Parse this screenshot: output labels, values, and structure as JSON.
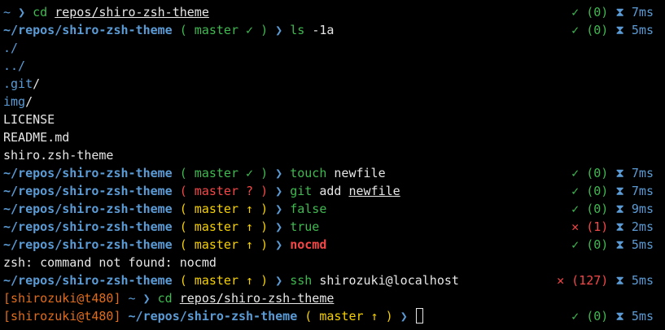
{
  "colors": {
    "background": "#000000",
    "text": "#e6e6e6",
    "path": "#5b9bd5",
    "prompt_arrow": "#5b9bd5",
    "git_clean": "#3fb950",
    "git_dirty": "#f44747",
    "git_ahead": "#f5d000",
    "command": "#3fb950",
    "command_error": "#f44747",
    "exit_ok": "#3fb950",
    "exit_fail": "#f44747",
    "duration": "#5b9bd5",
    "user_host": "#e06c1a",
    "dir_listing": "#5b9bd5"
  },
  "icons": {
    "check": "✓",
    "cross": "✕",
    "hourglass": "⧗",
    "chevron": "❯",
    "arrow_up": "↑"
  },
  "lines": [
    {
      "kind": "prompt",
      "segments": [
        {
          "t": "~ ",
          "c": "path"
        },
        {
          "t": "❯ ",
          "c": "prompt_arrow"
        },
        {
          "t": "cd ",
          "c": "command"
        },
        {
          "t": "repos/shiro-zsh-theme",
          "c": "text",
          "u": true
        }
      ],
      "status": {
        "icon": "✓",
        "code": "(0)",
        "ok": true,
        "time": "7ms"
      }
    },
    {
      "kind": "prompt",
      "segments": [
        {
          "t": "~/repos/shiro-zsh-theme ",
          "c": "path",
          "b": true
        },
        {
          "t": "( master ✓ ) ",
          "c": "git_clean"
        },
        {
          "t": "❯ ",
          "c": "prompt_arrow"
        },
        {
          "t": "ls ",
          "c": "command"
        },
        {
          "t": "-1a",
          "c": "text"
        }
      ],
      "status": {
        "icon": "✓",
        "code": "(0)",
        "ok": true,
        "time": "5ms"
      }
    },
    {
      "kind": "output",
      "segments": [
        {
          "t": "./",
          "c": "dir_listing"
        }
      ]
    },
    {
      "kind": "output",
      "segments": [
        {
          "t": "../",
          "c": "dir_listing"
        }
      ]
    },
    {
      "kind": "output",
      "segments": [
        {
          "t": ".git",
          "c": "dir_listing"
        },
        {
          "t": "/",
          "c": "text"
        }
      ]
    },
    {
      "kind": "output",
      "segments": [
        {
          "t": "img",
          "c": "dir_listing"
        },
        {
          "t": "/",
          "c": "text"
        }
      ]
    },
    {
      "kind": "output",
      "segments": [
        {
          "t": "LICENSE",
          "c": "text"
        }
      ]
    },
    {
      "kind": "output",
      "segments": [
        {
          "t": "README.md",
          "c": "text"
        }
      ]
    },
    {
      "kind": "output",
      "segments": [
        {
          "t": "shiro.zsh-theme",
          "c": "text"
        }
      ]
    },
    {
      "kind": "prompt",
      "segments": [
        {
          "t": "~/repos/shiro-zsh-theme ",
          "c": "path",
          "b": true
        },
        {
          "t": "( master ✓ ) ",
          "c": "git_clean"
        },
        {
          "t": "❯ ",
          "c": "prompt_arrow"
        },
        {
          "t": "touch ",
          "c": "command"
        },
        {
          "t": "newfile",
          "c": "text"
        }
      ],
      "status": {
        "icon": "✓",
        "code": "(0)",
        "ok": true,
        "time": "7ms"
      }
    },
    {
      "kind": "prompt",
      "segments": [
        {
          "t": "~/repos/shiro-zsh-theme ",
          "c": "path",
          "b": true
        },
        {
          "t": "( master ? ) ",
          "c": "git_dirty"
        },
        {
          "t": "❯ ",
          "c": "prompt_arrow"
        },
        {
          "t": "git ",
          "c": "command"
        },
        {
          "t": "add ",
          "c": "text"
        },
        {
          "t": "newfile",
          "c": "text",
          "u": true
        }
      ],
      "status": {
        "icon": "✓",
        "code": "(0)",
        "ok": true,
        "time": "7ms"
      }
    },
    {
      "kind": "prompt",
      "segments": [
        {
          "t": "~/repos/shiro-zsh-theme ",
          "c": "path",
          "b": true
        },
        {
          "t": "( master ↑ ) ",
          "c": "git_ahead"
        },
        {
          "t": "❯ ",
          "c": "prompt_arrow"
        },
        {
          "t": "false",
          "c": "command"
        }
      ],
      "status": {
        "icon": "✓",
        "code": "(0)",
        "ok": true,
        "time": "9ms"
      }
    },
    {
      "kind": "prompt",
      "segments": [
        {
          "t": "~/repos/shiro-zsh-theme ",
          "c": "path",
          "b": true
        },
        {
          "t": "( master ↑ ) ",
          "c": "git_ahead"
        },
        {
          "t": "❯ ",
          "c": "prompt_arrow"
        },
        {
          "t": "true",
          "c": "command"
        }
      ],
      "status": {
        "icon": "✕",
        "code": "(1)",
        "ok": false,
        "time": "2ms"
      }
    },
    {
      "kind": "prompt",
      "segments": [
        {
          "t": "~/repos/shiro-zsh-theme ",
          "c": "path",
          "b": true
        },
        {
          "t": "( master ↑ ) ",
          "c": "git_ahead"
        },
        {
          "t": "❯ ",
          "c": "prompt_arrow"
        },
        {
          "t": "nocmd",
          "c": "command_error",
          "b": true
        }
      ],
      "status": {
        "icon": "✓",
        "code": "(0)",
        "ok": true,
        "time": "5ms"
      }
    },
    {
      "kind": "output",
      "segments": [
        {
          "t": "zsh: command not found: nocmd",
          "c": "text"
        }
      ]
    },
    {
      "kind": "prompt",
      "segments": [
        {
          "t": "~/repos/shiro-zsh-theme ",
          "c": "path",
          "b": true
        },
        {
          "t": "( master ↑ ) ",
          "c": "git_ahead"
        },
        {
          "t": "❯ ",
          "c": "prompt_arrow"
        },
        {
          "t": "ssh ",
          "c": "command"
        },
        {
          "t": "shirozuki@localhost",
          "c": "text"
        }
      ],
      "status": {
        "icon": "✕",
        "code": "(127)",
        "ok": false,
        "time": "5ms"
      }
    },
    {
      "kind": "prompt",
      "segments": [
        {
          "t": "[shirozuki@t480] ",
          "c": "user_host"
        },
        {
          "t": "~ ",
          "c": "path"
        },
        {
          "t": "❯ ",
          "c": "prompt_arrow"
        },
        {
          "t": "cd ",
          "c": "command"
        },
        {
          "t": "repos/shiro-zsh-theme",
          "c": "text",
          "u": true
        }
      ]
    },
    {
      "kind": "prompt",
      "cursor": true,
      "segments": [
        {
          "t": "[shirozuki@t480] ",
          "c": "user_host"
        },
        {
          "t": "~/repos/shiro-zsh-theme ",
          "c": "path",
          "b": true
        },
        {
          "t": "( master ↑ ) ",
          "c": "git_ahead"
        },
        {
          "t": "❯ ",
          "c": "prompt_arrow"
        }
      ],
      "status": {
        "icon": "✓",
        "code": "(0)",
        "ok": true,
        "time": "5ms"
      }
    }
  ]
}
